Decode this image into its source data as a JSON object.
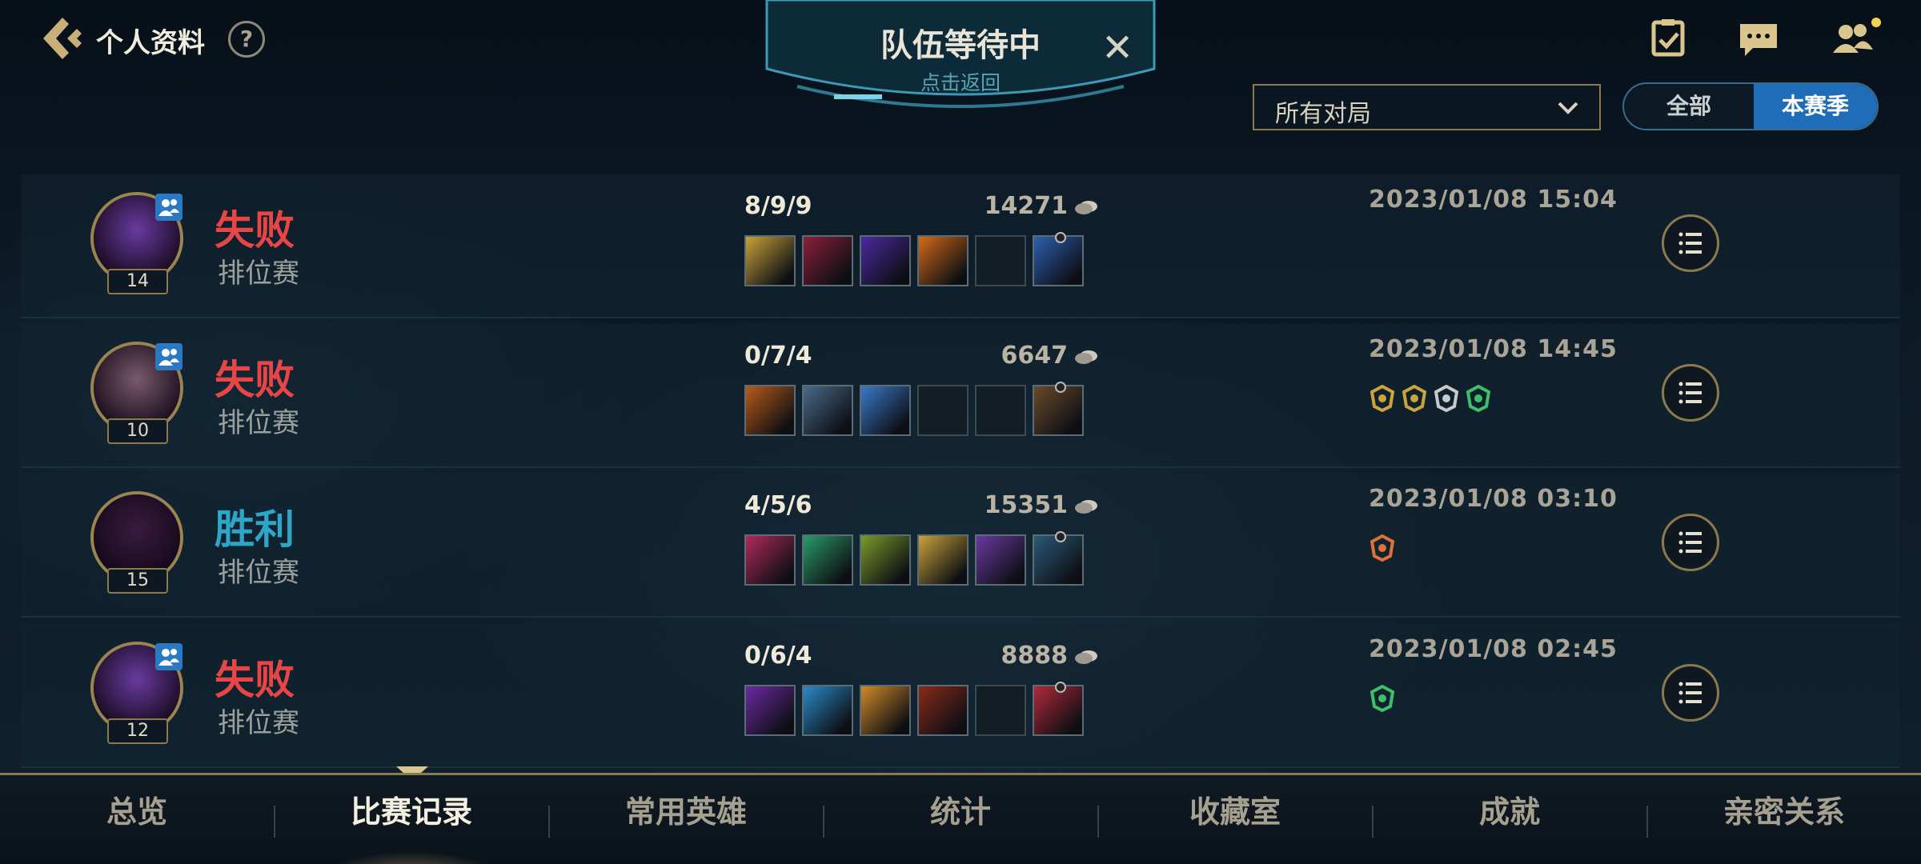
{
  "header": {
    "title": "个人资料",
    "help_glyph": "?"
  },
  "queue_banner": {
    "title": "队伍等待中",
    "subtitle": "点击返回",
    "close_glyph": "✕"
  },
  "top_icons": [
    "missions-icon",
    "chat-icon",
    "friends-icon"
  ],
  "filter": {
    "selected": "所有对局"
  },
  "season_toggle": {
    "options": [
      "全部",
      "本赛季"
    ],
    "selected": "本赛季"
  },
  "matches": [
    {
      "result": "失败",
      "outcome": "loss",
      "mode": "排位赛",
      "level": "14",
      "party": true,
      "kda": "8/9/9",
      "gold": "14271",
      "date": "2023/01/08 15:04",
      "items": [
        "#c8a23a",
        "#8a1f3a",
        "#4b2aa0",
        "#d46a1a",
        "",
        "#2d5fb0"
      ],
      "badges": [],
      "avatar_color": "#6a3aa0"
    },
    {
      "result": "失败",
      "outcome": "loss",
      "mode": "排位赛",
      "level": "10",
      "party": true,
      "kda": "0/7/4",
      "gold": "6647",
      "date": "2023/01/08 14:45",
      "items": [
        "#b85a1a",
        "#4a6a8a",
        "#3a7ac8",
        "",
        "",
        "#6a4a2a"
      ],
      "badges": [
        "#c9a53c",
        "#c9a53c",
        "#c9c9c9",
        "#3fbf6a"
      ],
      "avatar_color": "#7a5a6a"
    },
    {
      "result": "胜利",
      "outcome": "win",
      "mode": "排位赛",
      "level": "15",
      "party": false,
      "kda": "4/5/6",
      "gold": "15351",
      "date": "2023/01/08 03:10",
      "items": [
        "#b02a5a",
        "#2a9a6a",
        "#7a9a2a",
        "#c8a23a",
        "#6a3aa0",
        "#2a5a7a"
      ],
      "badges": [
        "#e0703a"
      ],
      "avatar_color": "#3a1a40"
    },
    {
      "result": "失败",
      "outcome": "loss",
      "mode": "排位赛",
      "level": "12",
      "party": true,
      "kda": "0/6/4",
      "gold": "8888",
      "date": "2023/01/08 02:45",
      "items": [
        "#6a2aa0",
        "#2a8ac8",
        "#d08a2a",
        "#8a2a1a",
        "",
        "#b02a3a"
      ],
      "badges": [
        "#3fbf6a"
      ],
      "avatar_color": "#6a3aa0"
    }
  ],
  "nav": {
    "items": [
      "总览",
      "比赛记录",
      "常用英雄",
      "统计",
      "收藏室",
      "成就",
      "亲密关系"
    ],
    "active": "比赛记录"
  },
  "colors": {
    "loss": "#e84646",
    "win": "#2ea6c8",
    "gold_border": "#8a7a4e",
    "accent_blue": "#1f6db8"
  }
}
